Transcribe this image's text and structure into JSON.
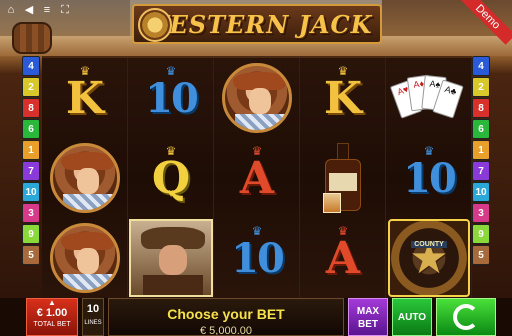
{
  "game": {
    "title": "WESTERN JACK",
    "demo_label": "Demo"
  },
  "topbar": {
    "icons": [
      "home-icon",
      "speaker-icon",
      "menu-icon",
      "fullscreen-icon"
    ]
  },
  "reels": [
    [
      "4",
      "2",
      "9"
    ],
    [
      "K",
      "10",
      "cowgirl"
    ],
    [
      "10",
      "Q",
      "sheriff"
    ],
    [
      "cowgirl",
      "A",
      "10"
    ],
    [
      "K",
      "whiskey",
      "A"
    ],
    [
      "cards",
      "10",
      "badge"
    ]
  ],
  "symbols": {
    "k": "K",
    "q": "Q",
    "ten": "10",
    "a": "A",
    "badge_text": "COUNTY"
  },
  "paylines": {
    "left": [
      "4",
      "2",
      "8",
      "6",
      "1",
      "7",
      "10",
      "3",
      "9",
      "5"
    ],
    "right": [
      "4",
      "2",
      "8",
      "6",
      "1",
      "7",
      "10",
      "3",
      "9",
      "5"
    ],
    "colors": [
      "#2a5ad8",
      "#d8c82a",
      "#d8302a",
      "#2ab83a",
      "#e8a02a",
      "#8a3ad8",
      "#2aa8d8",
      "#d83a8a",
      "#8ad83a",
      "#a86a3a"
    ]
  },
  "bottom": {
    "bet_value": "€ 1.00",
    "bet_label": "TOTAL BET",
    "lines_value": "10",
    "lines_label": "LINES",
    "message": "Choose your BET",
    "balance": "€ 5,000.00",
    "max_bet": "MAX BET",
    "auto": "AUTO"
  }
}
